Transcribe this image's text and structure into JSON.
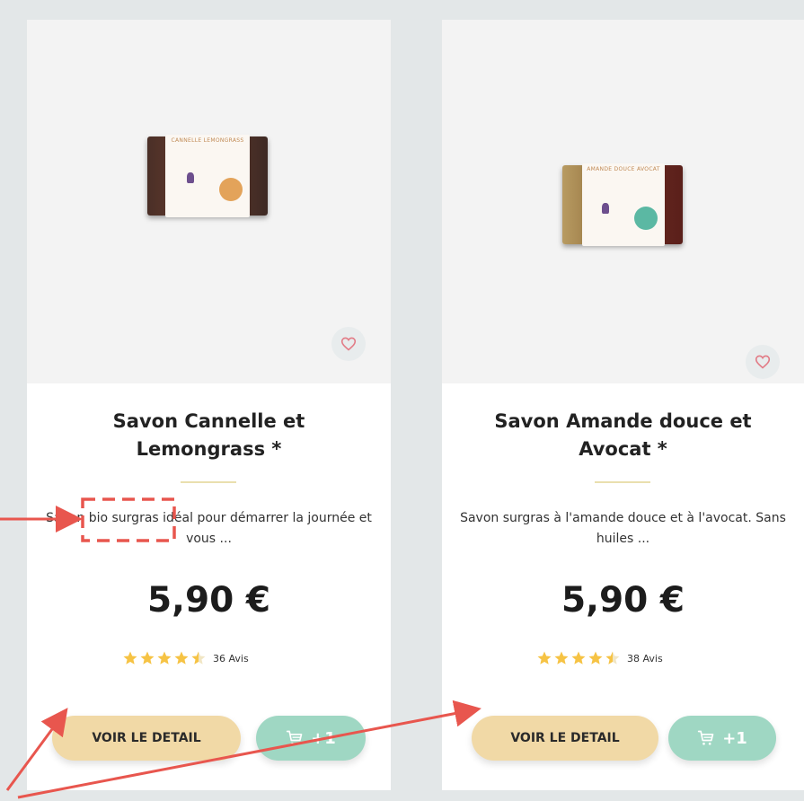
{
  "products": [
    {
      "soap_label": "CANNELLE LEMONGRASS",
      "title": "Savon Cannelle et Lemongrass *",
      "description": "Savon bio surgras idéal pour démarrer la journée et vous ...",
      "price": "5,90 €",
      "rating": 4.5,
      "reviews_count": "36",
      "reviews_label": "Avis",
      "detail_label": "VOIR LE DETAIL",
      "cart_label": "+1"
    },
    {
      "soap_label": "AMANDE DOUCE AVOCAT",
      "title": "Savon Amande douce et Avocat *",
      "description": "Savon surgras à l'amande douce et à l'avocat. Sans huiles ...",
      "price": "5,90 €",
      "rating": 4.5,
      "reviews_count": "38",
      "reviews_label": "Avis",
      "detail_label": "VOIR LE DETAIL",
      "cart_label": "+1"
    }
  ],
  "icons": {
    "favorite": "heart-outline-icon",
    "cart": "cart-icon",
    "star": "star-icon"
  },
  "colors": {
    "page_bg": "#e3e7e8",
    "detail_button": "#f1d9a6",
    "cart_button": "#9fd7c3",
    "star": "#f6c344",
    "heart": "#e27b86",
    "divider": "#eadfae",
    "annotation": "#e8564e"
  }
}
